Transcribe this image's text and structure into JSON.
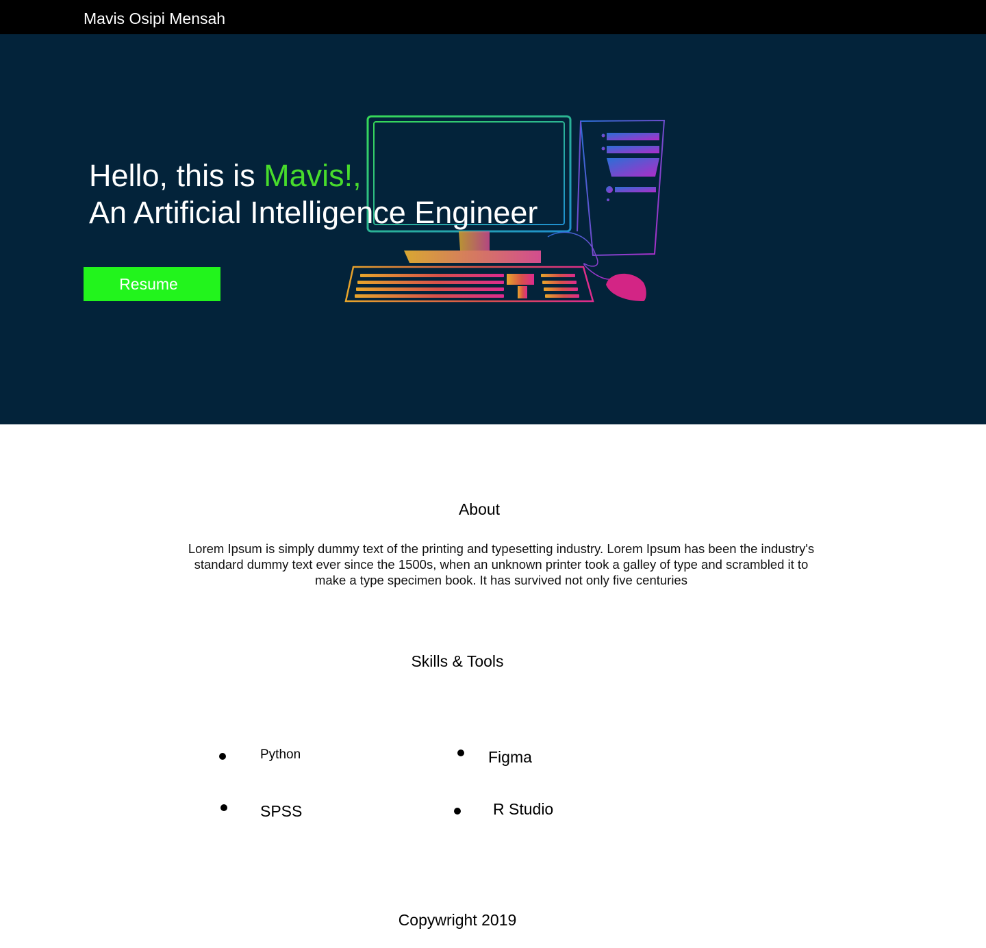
{
  "header": {
    "brand": "Mavis Osipi Mensah"
  },
  "hero": {
    "greeting": "Hello, this is ",
    "name": "Mavis!,",
    "role": "An Artificial Intelligence Engineer",
    "resume_label": "Resume",
    "illustration": "desktop-computer-illustration"
  },
  "about": {
    "title": "About",
    "text": "Lorem Ipsum is simply dummy text of the printing and typesetting industry. Lorem Ipsum has been the industry's standard dummy text ever since the 1500s, when an unknown printer took a galley of type and scrambled it to make a type specimen book. It has survived not only five centuries"
  },
  "skills": {
    "title": "Skills & Tools",
    "items": [
      "Python",
      "Figma",
      "SPSS",
      "R Studio"
    ]
  },
  "footer": {
    "copyright": "Copywright 2019"
  },
  "colors": {
    "topbar": "#000000",
    "hero_background": "#03233a",
    "accent_text": "#48dc2c",
    "resume_button": "#22f41c"
  }
}
